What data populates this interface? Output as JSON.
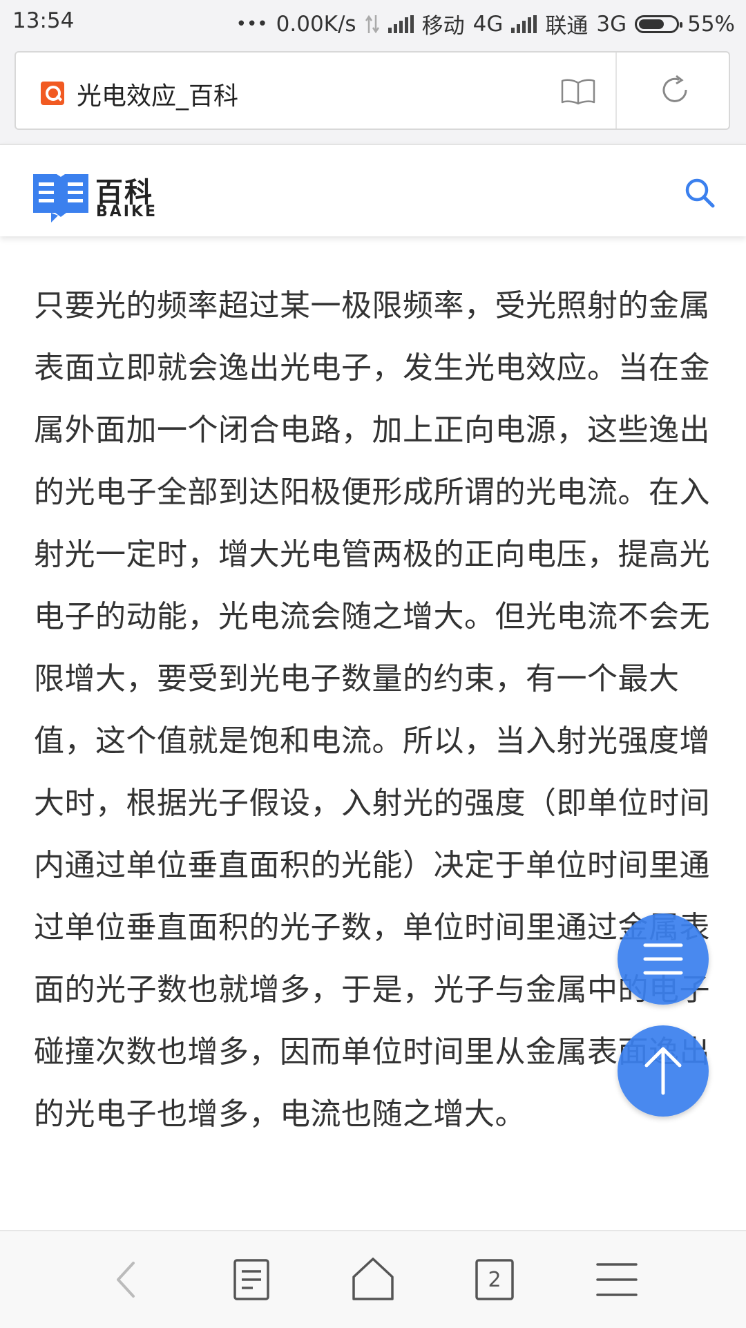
{
  "status_bar": {
    "time": "13:54",
    "dots": "•••",
    "speed": "0.00K/s",
    "carrier1": "移动",
    "network1": "4G",
    "carrier2": "联通",
    "network2": "3G",
    "battery": "55%"
  },
  "address_bar": {
    "title": "光电效应_百科",
    "icons": [
      "search-logo-icon",
      "reader-mode-icon",
      "refresh-icon"
    ]
  },
  "header": {
    "logo_cn": "百科",
    "logo_en": "BAIKE",
    "brand_color": "#3b80ee"
  },
  "article": {
    "text": "只要光的频率超过某一极限频率，受光照射的金属表面立即就会逸出光电子，发生光电效应。当在金属外面加一个闭合电路，加上正向电源，这些逸出的光电子全部到达阳极便形成所谓的光电流。在入射光一定时，增大光电管两极的正向电压，提高光电子的动能，光电流会随之增大。但光电流不会无限增大，要受到光电子数量的约束，有一个最大值，这个值就是饱和电流。所以，当入射光强度增大时，根据光子假设，入射光的强度（即单位时间内通过单位垂直面积的光能）决定于单位时间里通过单位垂直面积的光子数，单位时间里通过金属表面的光子数也就增多，于是，光子与金属中的电子碰撞次数也增多，因而单位时间里从金属表面逸出的光电子也增多，电流也随之增大。"
  },
  "floating": {
    "toc_icon": "list-icon",
    "top_icon": "arrow-up-icon"
  },
  "toolbar": {
    "tabs_count": "2",
    "icons": [
      "back-icon",
      "bookmarks-icon",
      "home-icon",
      "tabs-icon",
      "menu-icon"
    ]
  }
}
